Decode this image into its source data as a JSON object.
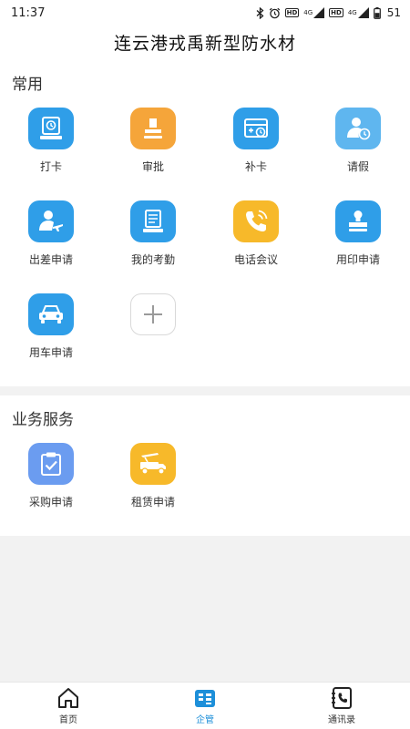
{
  "status_bar": {
    "time": "11:37",
    "hd_1": "HD",
    "net_1": "4G",
    "hd_2": "HD",
    "net_2": "4G",
    "battery": "51"
  },
  "header": {
    "title": "连云港戎禹新型防水材"
  },
  "sections": {
    "common": {
      "title": "常用",
      "items": [
        {
          "label": "打卡",
          "icon": "clock-in-icon",
          "color": "#2f9ee8"
        },
        {
          "label": "审批",
          "icon": "approval-stamp-icon",
          "color": "#f5a53a"
        },
        {
          "label": "补卡",
          "icon": "makeup-card-icon",
          "color": "#2f9ee8"
        },
        {
          "label": "请假",
          "icon": "leave-person-icon",
          "color": "#5fb6ef"
        },
        {
          "label": "出差申请",
          "icon": "business-trip-icon",
          "color": "#2f9ee8"
        },
        {
          "label": "我的考勤",
          "icon": "attendance-doc-icon",
          "color": "#2f9ee8"
        },
        {
          "label": "电话会议",
          "icon": "phone-call-icon",
          "color": "#f7b92a"
        },
        {
          "label": "用印申请",
          "icon": "seal-stamp-icon",
          "color": "#2f9ee8"
        },
        {
          "label": "用车申请",
          "icon": "car-icon",
          "color": "#2f9ee8"
        }
      ],
      "add_icon": "plus-icon"
    },
    "business": {
      "title": "业务服务",
      "items": [
        {
          "label": "采购申请",
          "icon": "purchase-clipboard-icon",
          "color": "#6b9cf0"
        },
        {
          "label": "租赁申请",
          "icon": "lease-truck-icon",
          "color": "#f7b92a"
        }
      ]
    }
  },
  "bottom_nav": {
    "items": [
      {
        "label": "首页",
        "icon": "home-icon",
        "active": false
      },
      {
        "label": "企管",
        "icon": "enterprise-icon",
        "active": true
      },
      {
        "label": "通讯录",
        "icon": "contacts-phone-icon",
        "active": false
      }
    ],
    "active_color": "#1d8fd9"
  }
}
